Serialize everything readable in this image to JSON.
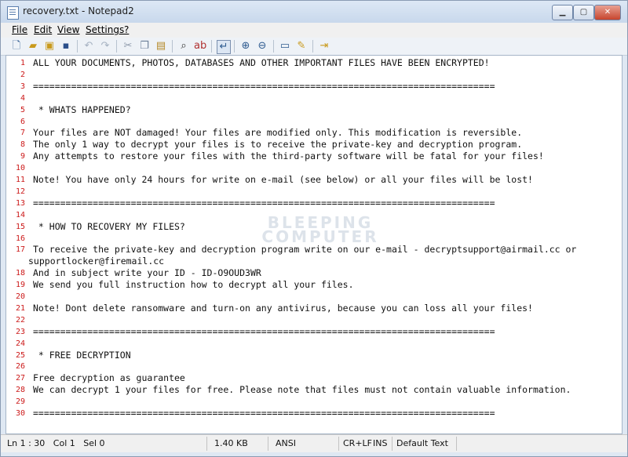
{
  "window": {
    "title": "recovery.txt - Notepad2"
  },
  "controls": {
    "minimize": "▁",
    "maximize": "▢",
    "close": "✕"
  },
  "menu": [
    {
      "label": "File"
    },
    {
      "label": "Edit"
    },
    {
      "label": "View"
    },
    {
      "label": "Settings"
    },
    {
      "label": "?"
    }
  ],
  "toolbar": {
    "icons": [
      "new-file-icon",
      "open-folder-icon",
      "browse-icon",
      "save-icon",
      "undo-icon",
      "redo-icon",
      "cut-icon",
      "copy-icon",
      "paste-icon",
      "find-icon",
      "replace-icon",
      "word-wrap-icon",
      "zoom-in-icon",
      "zoom-out-icon",
      "settings-icon",
      "edit-scheme-icon",
      "exit-icon"
    ]
  },
  "watermark": {
    "line1": "BLEEPING",
    "line2": "COMPUTER"
  },
  "lines": [
    {
      "num": "1",
      "text": "ALL YOUR DOCUMENTS, PHOTOS, DATABASES AND OTHER IMPORTANT FILES HAVE BEEN ENCRYPTED!"
    },
    {
      "num": "2",
      "text": ""
    },
    {
      "num": "3",
      "text": "====================================================================================="
    },
    {
      "num": "4",
      "text": ""
    },
    {
      "num": "5",
      "text": " * WHATS HAPPENED?"
    },
    {
      "num": "6",
      "text": ""
    },
    {
      "num": "7",
      "text": "Your files are NOT damaged! Your files are modified only. This modification is reversible."
    },
    {
      "num": "8",
      "text": "The only 1 way to decrypt your files is to receive the private-key and decryption program."
    },
    {
      "num": "9",
      "text": "Any attempts to restore your files with the third-party software will be fatal for your files!"
    },
    {
      "num": "10",
      "text": ""
    },
    {
      "num": "11",
      "text": "Note! You have only 24 hours for write on e-mail (see below) or all your files will be lost!"
    },
    {
      "num": "12",
      "text": ""
    },
    {
      "num": "13",
      "text": "====================================================================================="
    },
    {
      "num": "14",
      "text": ""
    },
    {
      "num": "15",
      "text": " * HOW TO RECOVERY MY FILES?"
    },
    {
      "num": "16",
      "text": ""
    },
    {
      "num": "17",
      "text": "To receive the private-key and decryption program write on our e-mail - decryptsupport@airmail.cc or"
    },
    {
      "num": "",
      "text": "supportlocker@firemail.cc"
    },
    {
      "num": "18",
      "text": "And in subject write your ID - ID-O9OUD3WR"
    },
    {
      "num": "19",
      "text": "We send you full instruction how to decrypt all your files."
    },
    {
      "num": "20",
      "text": ""
    },
    {
      "num": "21",
      "text": "Note! Dont delete ransomware and turn-on any antivirus, because you can loss all your files!"
    },
    {
      "num": "22",
      "text": ""
    },
    {
      "num": "23",
      "text": "====================================================================================="
    },
    {
      "num": "24",
      "text": ""
    },
    {
      "num": "25",
      "text": " * FREE DECRYPTION"
    },
    {
      "num": "26",
      "text": ""
    },
    {
      "num": "27",
      "text": "Free decryption as guarantee"
    },
    {
      "num": "28",
      "text": "We can decrypt 1 your files for free. Please note that files must not contain valuable information."
    },
    {
      "num": "29",
      "text": ""
    },
    {
      "num": "30",
      "text": "====================================================================================="
    }
  ],
  "status": {
    "position": "Ln 1 : 30   Col 1   Sel 0",
    "size": "1.40 KB",
    "encoding": "ANSI",
    "eol": "CR+LF",
    "mode": "INS",
    "scheme": "Default Text"
  }
}
